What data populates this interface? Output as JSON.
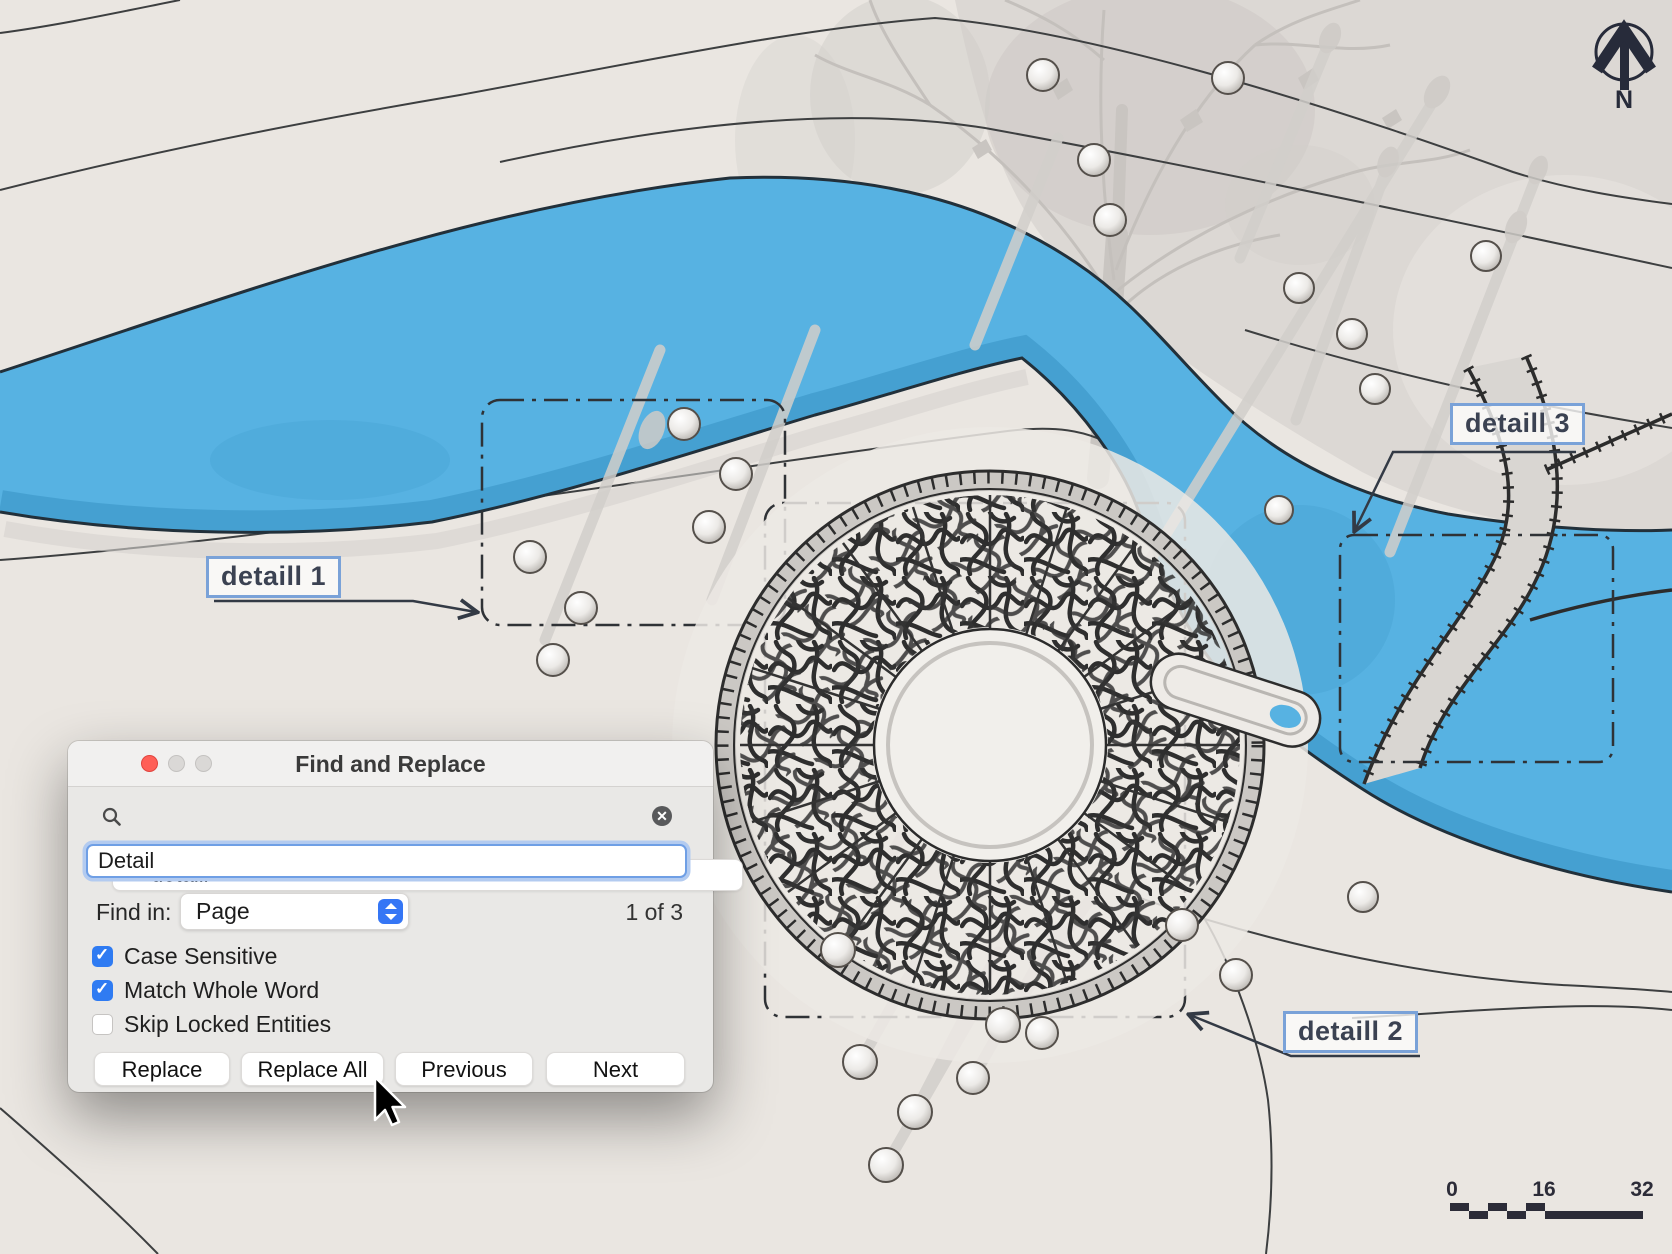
{
  "dialog": {
    "title": "Find and Replace",
    "search": {
      "value": "detaill",
      "clear_glyph": "✕"
    },
    "replace": {
      "value": "Detail"
    },
    "find_in": {
      "label": "Find in:",
      "value": "Page"
    },
    "match_count": "1 of 3",
    "checkboxes": [
      {
        "label": "Case Sensitive",
        "checked": "true"
      },
      {
        "label": "Match Whole Word",
        "checked": "true"
      },
      {
        "label": "Skip Locked Entities",
        "checked": "false"
      }
    ],
    "buttons": [
      {
        "label": "Replace"
      },
      {
        "label": "Replace All"
      },
      {
        "label": "Previous"
      },
      {
        "label": "Next"
      }
    ]
  },
  "canvas": {
    "detail_labels": [
      {
        "text": "detaill 1"
      },
      {
        "text": "detaill 2"
      },
      {
        "text": "detaill 3"
      }
    ],
    "north_label": "N",
    "scale": {
      "ticks": [
        "0",
        "16",
        "32"
      ]
    },
    "colors": {
      "paper": "#eae6e1",
      "river": "#57b2e2",
      "river_shade": "#459fd0",
      "label_accent": "#7aa2d8",
      "ink": "#2d2d2d"
    }
  }
}
